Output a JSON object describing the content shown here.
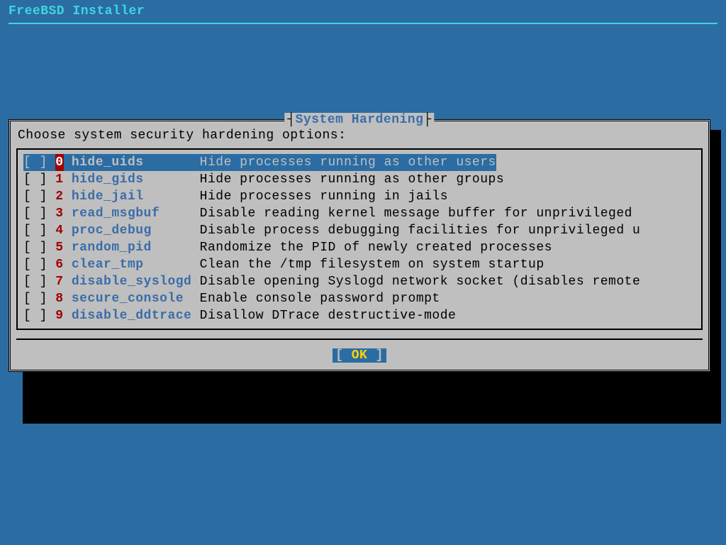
{
  "app_title": "FreeBSD Installer",
  "dialog": {
    "title": "System Hardening",
    "prompt": "Choose system security hardening options:",
    "options": [
      {
        "num": "0",
        "name": "hide_uids",
        "desc": "Hide processes running as other users",
        "checked": false,
        "selected": true
      },
      {
        "num": "1",
        "name": "hide_gids",
        "desc": "Hide processes running as other groups",
        "checked": false,
        "selected": false
      },
      {
        "num": "2",
        "name": "hide_jail",
        "desc": "Hide processes running in jails",
        "checked": false,
        "selected": false
      },
      {
        "num": "3",
        "name": "read_msgbuf",
        "desc": "Disable reading kernel message buffer for unprivileged",
        "checked": false,
        "selected": false
      },
      {
        "num": "4",
        "name": "proc_debug",
        "desc": "Disable process debugging facilities for unprivileged u",
        "checked": false,
        "selected": false
      },
      {
        "num": "5",
        "name": "random_pid",
        "desc": "Randomize the PID of newly created processes",
        "checked": false,
        "selected": false
      },
      {
        "num": "6",
        "name": "clear_tmp",
        "desc": "Clean the /tmp filesystem on system startup",
        "checked": false,
        "selected": false
      },
      {
        "num": "7",
        "name": "disable_syslogd",
        "desc": "Disable opening Syslogd network socket (disables remote",
        "checked": false,
        "selected": false
      },
      {
        "num": "8",
        "name": "secure_console",
        "desc": "Enable console password prompt",
        "checked": false,
        "selected": false
      },
      {
        "num": "9",
        "name": "disable_ddtrace",
        "desc": "Disallow DTrace destructive-mode",
        "checked": false,
        "selected": false
      }
    ],
    "ok_label": "OK"
  }
}
